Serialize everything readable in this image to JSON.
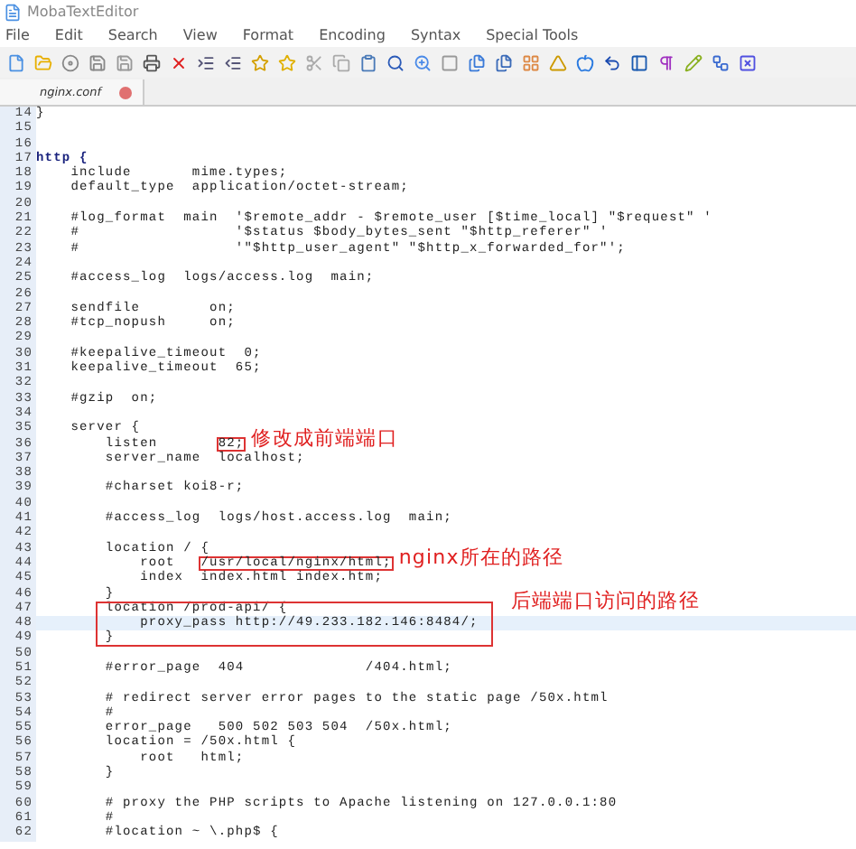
{
  "window": {
    "title": "MobaTextEditor"
  },
  "menu": [
    "File",
    "Edit",
    "Search",
    "View",
    "Format",
    "Encoding",
    "Syntax",
    "Special Tools"
  ],
  "tabs": [
    {
      "label": "nginx.conf",
      "selected": true
    }
  ],
  "code": [
    {
      "kind": "line",
      "number": "14",
      "text": "}"
    },
    {
      "kind": "line",
      "number": "15"
    },
    {
      "kind": "line",
      "number": "16"
    },
    {
      "kind": "line",
      "number": "17",
      "text": "http {",
      "bold": true
    },
    {
      "kind": "line",
      "number": "18",
      "text": "    include       mime.types;"
    },
    {
      "kind": "line",
      "number": "19",
      "text": "    default_type  application/octet-stream;"
    },
    {
      "kind": "line",
      "number": "20"
    },
    {
      "kind": "line",
      "number": "21",
      "text": "    #log_format  main  '$remote_addr - $remote_user [$time_local] \"$request\" '"
    },
    {
      "kind": "line",
      "number": "22",
      "text": "    #                  '$status $body_bytes_sent \"$http_referer\" '"
    },
    {
      "kind": "line",
      "number": "23",
      "text": "    #                  '\"$http_user_agent\" \"$http_x_forwarded_for\"';"
    },
    {
      "kind": "line",
      "number": "24"
    },
    {
      "kind": "line",
      "number": "25",
      "text": "    #access_log  logs/access.log  main;"
    },
    {
      "kind": "line",
      "number": "26"
    },
    {
      "kind": "line",
      "number": "27",
      "text": "    sendfile        on;"
    },
    {
      "kind": "line",
      "number": "28",
      "text": "    #tcp_nopush     on;"
    },
    {
      "kind": "line",
      "number": "29"
    },
    {
      "kind": "line",
      "number": "30",
      "text": "    #keepalive_timeout  0;"
    },
    {
      "kind": "line",
      "number": "31",
      "text": "    keepalive_timeout  65;"
    },
    {
      "kind": "line",
      "number": "32"
    },
    {
      "kind": "line",
      "number": "33",
      "text": "    #gzip  on;"
    },
    {
      "kind": "line",
      "number": "34"
    },
    {
      "kind": "line",
      "number": "35",
      "text": "    server {"
    },
    {
      "kind": "line",
      "number": "36",
      "parts": [
        {
          "text": "        listen       ",
          "boxed": false
        },
        {
          "text": "82;",
          "boxed": true
        }
      ],
      "note": "修改成前端端口"
    },
    {
      "kind": "line",
      "number": "37",
      "text": "        server_name  localhost;"
    },
    {
      "kind": "line",
      "number": "38"
    },
    {
      "kind": "line",
      "number": "39",
      "text": "        #charset koi8-r;"
    },
    {
      "kind": "line",
      "number": "40"
    },
    {
      "kind": "line",
      "number": "41",
      "text": "        #access_log  logs/host.access.log  main;"
    },
    {
      "kind": "line",
      "number": "42"
    },
    {
      "kind": "line",
      "number": "43",
      "text": "        location / {"
    },
    {
      "kind": "line",
      "number": "44",
      "parts": [
        {
          "text": "            root   ",
          "boxed": false
        },
        {
          "text": "/usr/local/nginx/html;",
          "boxed": true
        }
      ],
      "note": "nginx所在的路径"
    },
    {
      "kind": "line",
      "number": "45",
      "text": "            index  index.html index.htm;"
    },
    {
      "kind": "line",
      "number": "46",
      "text": "        }"
    },
    {
      "kind": "block",
      "note": "后端端口访问的路径",
      "lines": [
        {
          "kind": "line",
          "number": "47",
          "text": "        location /prod-api/ {"
        },
        {
          "kind": "line",
          "number": "48",
          "text": "            proxy_pass http://49.233.182.146:8484/;",
          "current": true
        },
        {
          "kind": "line",
          "number": "49",
          "text": "        }"
        }
      ]
    },
    {
      "kind": "line",
      "number": "50"
    },
    {
      "kind": "line",
      "number": "51",
      "text": "        #error_page  404              /404.html;"
    },
    {
      "kind": "line",
      "number": "52"
    },
    {
      "kind": "line",
      "number": "53",
      "text": "        # redirect server error pages to the static page /50x.html"
    },
    {
      "kind": "line",
      "number": "54",
      "text": "        #"
    },
    {
      "kind": "line",
      "number": "55",
      "text": "        error_page   500 502 503 504  /50x.html;"
    },
    {
      "kind": "line",
      "number": "56",
      "text": "        location = /50x.html {"
    },
    {
      "kind": "line",
      "number": "57",
      "text": "            root   html;"
    },
    {
      "kind": "line",
      "number": "58",
      "text": "        }"
    },
    {
      "kind": "line",
      "number": "59"
    },
    {
      "kind": "line",
      "number": "60",
      "text": "        # proxy the PHP scripts to Apache listening on 127.0.0.1:80"
    },
    {
      "kind": "line",
      "number": "61",
      "text": "        #"
    },
    {
      "kind": "line",
      "number": "62",
      "text": "        #location ~ \\.php$ {"
    }
  ]
}
